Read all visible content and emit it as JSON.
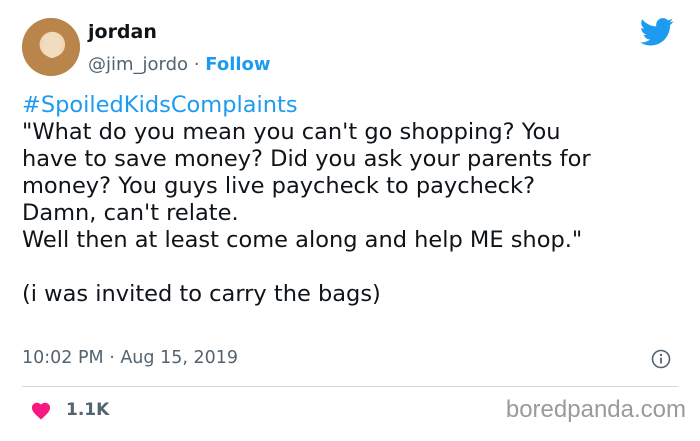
{
  "author": {
    "name": "jordan",
    "handle": "@jim_jordo",
    "separator": "·",
    "follow_label": "Follow"
  },
  "tweet": {
    "hashtag": "#SpoiledKidsComplaints",
    "lines": [
      "\"What do you mean you can't go shopping? You",
      "have to save money? Did you ask your parents for",
      "money? You guys live paycheck to paycheck?",
      "Damn, can't relate.",
      "Well then at least come along and help ME shop.\"",
      "(i was invited to carry the bags)"
    ]
  },
  "timestamp": "10:02 PM · Aug 15, 2019",
  "likes": {
    "count": "1.1K"
  },
  "watermark": "boredpanda.com",
  "colors": {
    "accent": "#1d9bf0",
    "heart": "#f91880",
    "secondary_text": "#536471"
  },
  "icons": {
    "logo": "twitter-bird-icon",
    "info": "info-icon",
    "like": "heart-icon"
  }
}
